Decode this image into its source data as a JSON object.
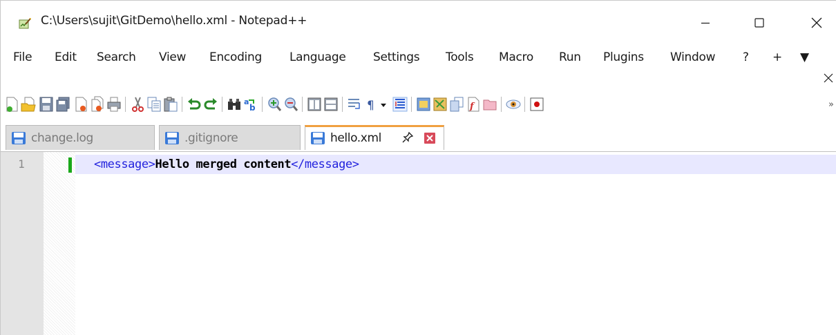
{
  "window": {
    "title": "C:\\Users\\sujit\\GitDemo\\hello.xml - Notepad++"
  },
  "menu": {
    "items": [
      "File",
      "Edit",
      "Search",
      "View",
      "Encoding",
      "Language",
      "Settings",
      "Tools",
      "Macro",
      "Run",
      "Plugins",
      "Window",
      "?",
      "+",
      "▼"
    ]
  },
  "toolbar": {
    "icons": [
      "new-file-icon",
      "open-file-icon",
      "save-icon",
      "save-all-icon",
      "close-icon",
      "close-all-icon",
      "print-icon",
      "cut-icon",
      "copy-icon",
      "paste-icon",
      "undo-icon",
      "redo-icon",
      "find-icon",
      "replace-icon",
      "zoom-in-icon",
      "zoom-out-icon",
      "sync-vertical-icon",
      "sync-horizontal-icon",
      "word-wrap-icon",
      "show-all-characters-icon",
      "dropdown-icon",
      "indent-guide-icon",
      "udl-icon",
      "document-map-icon",
      "document-list-icon",
      "function-list-icon",
      "folder-workspace-icon",
      "monitoring-icon",
      "record-macro-icon",
      "overflow-icon"
    ],
    "overflow_label": "»"
  },
  "tabs": [
    {
      "label": "change.log",
      "active": false
    },
    {
      "label": ".gitignore",
      "active": false
    },
    {
      "label": "hello.xml",
      "active": true
    }
  ],
  "editor": {
    "line_number": "1",
    "open_tag": "<message>",
    "text": "Hello merged content",
    "close_tag": "</message>"
  },
  "colors": {
    "tag": "#2222dd",
    "active_tab_accent": "#f0a040",
    "change_marker": "#1aa81a",
    "current_line": "#e8e8ff"
  }
}
